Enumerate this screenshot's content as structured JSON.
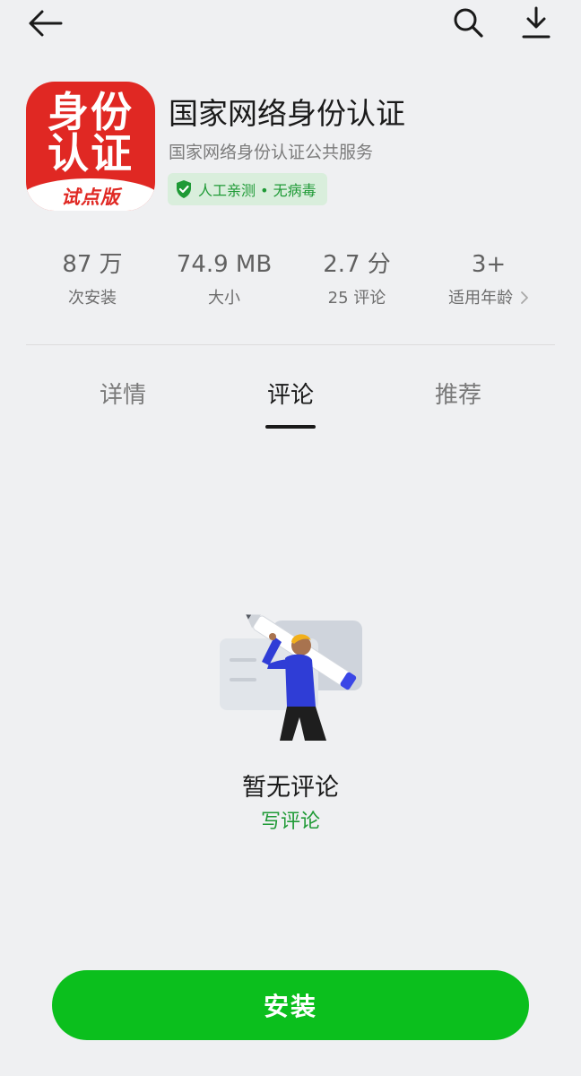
{
  "app": {
    "icon_line1": "身份",
    "icon_line2": "认证",
    "icon_banner": "试点版",
    "name": "国家网络身份认证",
    "developer": "国家网络身份认证公共服务",
    "badge": "人工亲测 • 无病毒"
  },
  "stats": [
    {
      "value": "87 万",
      "label": "次安装"
    },
    {
      "value": "74.9 MB",
      "label": "大小"
    },
    {
      "value": "2.7 分",
      "label": "25 评论"
    },
    {
      "value": "3+",
      "label": "适用年龄"
    }
  ],
  "tabs": [
    {
      "label": "详情",
      "active": false
    },
    {
      "label": "评论",
      "active": true
    },
    {
      "label": "推荐",
      "active": false
    }
  ],
  "empty_state": {
    "title": "暂无评论",
    "action": "写评论"
  },
  "install_button": "安装",
  "icons": {
    "back": "back-arrow-icon",
    "search": "search-icon",
    "download": "download-icon",
    "badge": "shield-check-icon",
    "age_more": "chevron-right-icon"
  },
  "colors": {
    "background": "#eff0f2",
    "brand_green": "#0bbf1d",
    "badge_green": "#1f9a36",
    "app_icon_red": "#e02823"
  }
}
